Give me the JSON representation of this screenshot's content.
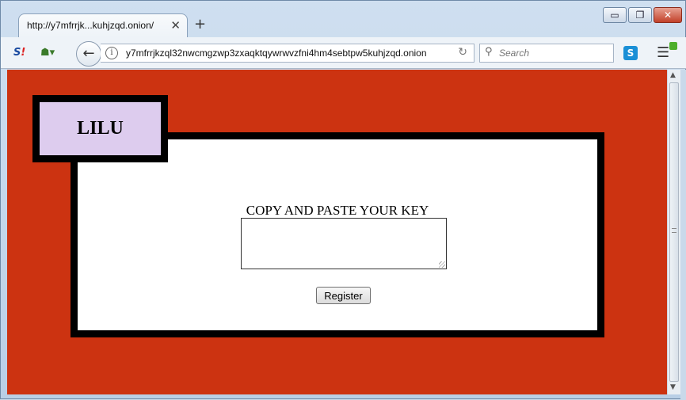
{
  "browser": {
    "tab_title": "http://y7mfrrjk...kuhjzqd.onion/",
    "tab_close": "✕",
    "new_tab": "+",
    "url": "y7mfrrjkzql32nwcmgzwp3zxaqktqywrwvzfni4hm4sebtpw5kuhjzqd.onion",
    "search_placeholder": "Search",
    "window_controls": {
      "minimize": "▭",
      "maximize": "❐",
      "close": "✕"
    }
  },
  "page": {
    "logo": "LILU",
    "key_label": "COPY AND PASTE YOUR KEY",
    "key_value": "",
    "register_label": "Register",
    "background_color": "#cc3311",
    "logo_color": "#ddccee"
  },
  "icons": {
    "back": "back-arrow-icon",
    "info": "info-icon",
    "reload": "reload-icon",
    "search": "search-icon",
    "menu": "hamburger-menu-icon"
  }
}
